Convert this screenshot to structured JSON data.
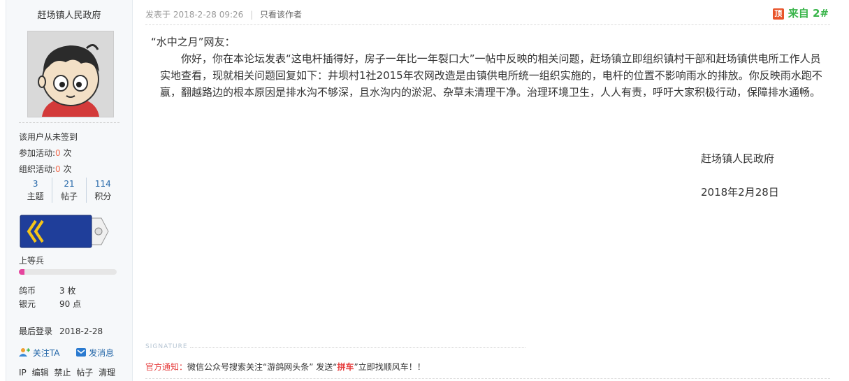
{
  "author": {
    "name": "赶场镇人民政府",
    "checkin_status": "该用户从未签到",
    "join_activity_label": "参加活动:",
    "join_activity_count": "0",
    "organize_activity_label": "组织活动:",
    "organize_activity_count": "0",
    "times_unit": "次",
    "stats": [
      {
        "value": "3",
        "label": "主题"
      },
      {
        "value": "21",
        "label": "帖子"
      },
      {
        "value": "114",
        "label": "积分"
      }
    ],
    "rank": "上等兵",
    "rank_progress": 0.06,
    "currency": [
      {
        "label": "鸽币",
        "value": "3 枚"
      },
      {
        "label": "银元",
        "value": "90 点"
      }
    ],
    "last_login_label": "最后登录",
    "last_login_value": "2018-2-28",
    "follow_label": "关注TA",
    "message_label": "发消息",
    "admin_links": [
      "IP",
      "编辑",
      "禁止",
      "帖子",
      "清理"
    ]
  },
  "post": {
    "posted_at": "发表于 2018-2-28 09:26",
    "only_author": "只看该作者",
    "floor_label": "来自 2#",
    "top_icon": "顶",
    "greeting": "“水中之月”网友：",
    "body": "你好，你在本论坛发表“这电杆插得好，房子一年比一年裂口大”一帖中反映的相关问题，赶场镇立即组织镇村干部和赶场镇供电所工作人员实地查看，现就相关问题回复如下：井坝村1社2015年农网改造是由镇供电所统一组织实施的，电杆的位置不影响雨水的排放。你反映雨水跑不赢，翻越路边的根本原因是排水沟不够深，且水沟内的淤泥、杂草未清理干净。治理环境卫生，人人有责，呼吁大家积极行动，保障排水通畅。",
    "sign_org": "赶场镇人民政府",
    "sign_date": "2018年2月28日",
    "signature_label": "SIGNATURE",
    "notice_label": "官方通知：",
    "notice_pre": "微信公众号搜索关注“游鸽网头条” 发送“",
    "notice_keyword": "拼车",
    "notice_post": "”立即找顺风车！！"
  },
  "colors": {
    "link": "#2366a8",
    "accent_red": "#e63c3c",
    "floor_green": "#39b54a",
    "progress_pink": "#e5459e"
  }
}
